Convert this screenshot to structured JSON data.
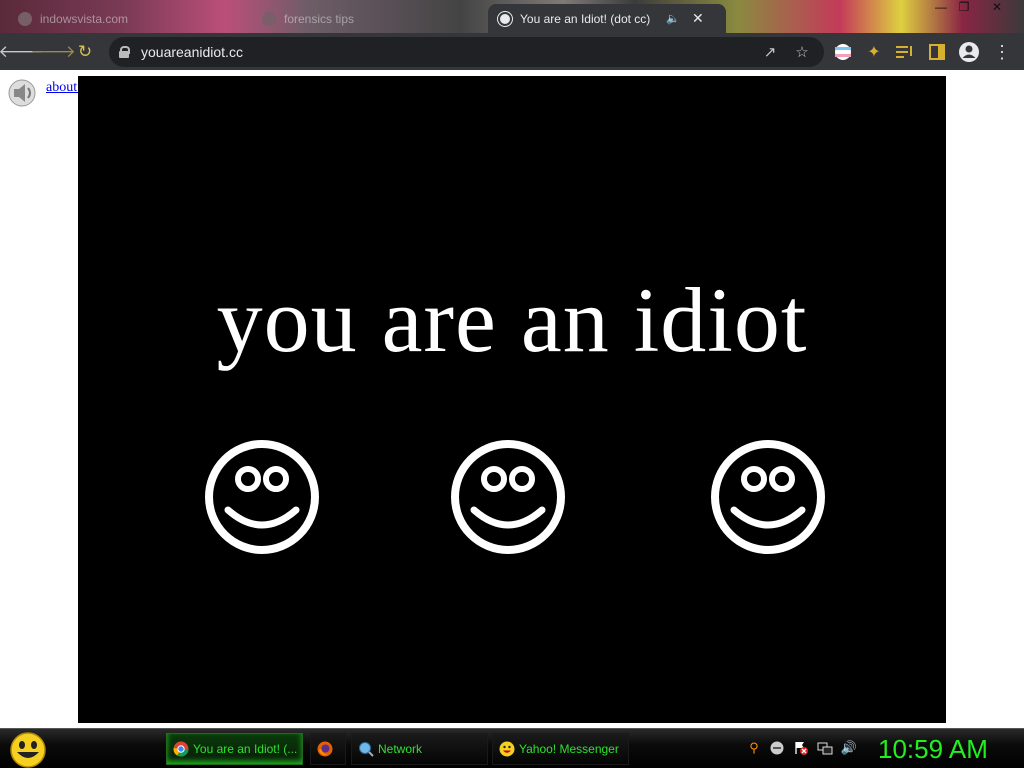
{
  "browser": {
    "tabs": [
      {
        "title": "indowsvista.com",
        "active": false
      },
      {
        "title": "forensics tips",
        "active": false
      },
      {
        "title": "You are an Idiot! (dot cc)",
        "active": true
      }
    ],
    "url": "youareanidiot.cc",
    "icons": {
      "back": "arrow-left-icon",
      "forward": "arrow-right-icon",
      "reload": "reload-icon",
      "share": "share-icon",
      "bookmark": "star-icon",
      "extensions": "puzzle-icon",
      "menu": "kebab-menu-icon"
    }
  },
  "page": {
    "about_link": "about blank",
    "headline": "you are an idiot",
    "smiley_count": 3
  },
  "taskbar": {
    "tasks": [
      {
        "label": "You are an Idiot! (..."
      },
      {
        "label": ""
      },
      {
        "label": "Network"
      },
      {
        "label": "Yahoo! Messenger"
      }
    ],
    "clock": "10:59 AM"
  },
  "colors": {
    "clock": "#22ee22",
    "task_text": "#2fe02f",
    "stage": "#000000"
  }
}
